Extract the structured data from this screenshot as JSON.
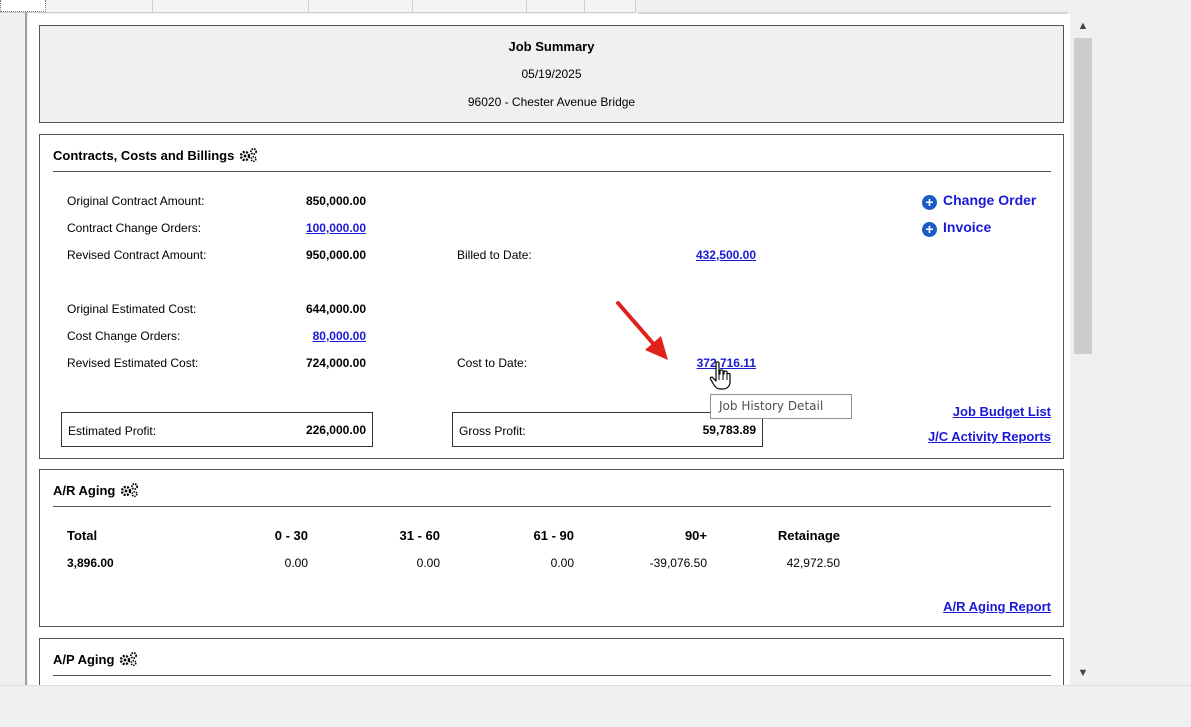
{
  "summary": {
    "title": "Job Summary",
    "date": "05/19/2025",
    "job": "96020 - Chester Avenue Bridge"
  },
  "contracts": {
    "heading": "Contracts, Costs and Billings",
    "original_contract_label": "Original Contract Amount:",
    "original_contract_value": "850,000.00",
    "contract_change_label": "Contract Change Orders:",
    "contract_change_value": "100,000.00",
    "revised_contract_label": "Revised Contract Amount:",
    "revised_contract_value": "950,000.00",
    "billed_label": "Billed to Date:",
    "billed_value": "432,500.00",
    "original_cost_label": "Original Estimated Cost:",
    "original_cost_value": "644,000.00",
    "cost_change_label": "Cost Change Orders:",
    "cost_change_value": "80,000.00",
    "revised_cost_label": "Revised Estimated Cost:",
    "revised_cost_value": "724,000.00",
    "cost_to_date_label": "Cost to Date:",
    "cost_to_date_value": "372,716.11",
    "est_profit_label": "Estimated Profit:",
    "est_profit_value": "226,000.00",
    "gross_profit_label": "Gross Profit:",
    "gross_profit_value": "59,783.89",
    "change_order_action": "Change Order",
    "invoice_action": "Invoice",
    "job_budget_link": "Job Budget List",
    "jc_activity_link": "J/C Activity Reports",
    "tooltip": "Job History Detail"
  },
  "ar_aging": {
    "heading": "A/R Aging",
    "columns": [
      "Total",
      "0 - 30",
      "31 - 60",
      "61 - 90",
      "90+",
      "Retainage"
    ],
    "values": [
      "3,896.00",
      "0.00",
      "0.00",
      "0.00",
      "-39,076.50",
      "42,972.50"
    ],
    "report_link": "A/R Aging Report"
  },
  "ap_aging": {
    "heading": "A/P Aging"
  },
  "colors": {
    "link": "#1a1ad6",
    "annotation_arrow": "#e0211c"
  }
}
